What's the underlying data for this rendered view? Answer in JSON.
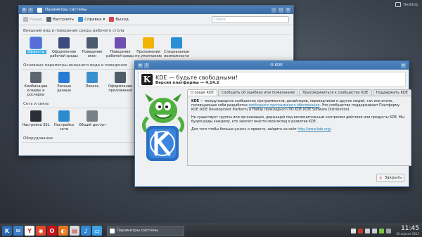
{
  "desktop": {
    "label": "Desktop"
  },
  "settings_window": {
    "title": "Параметры системы",
    "toolbar": {
      "back": "Назад",
      "configure": "Настроить",
      "help": "Справка",
      "quit": "Выход",
      "search_placeholder": "Поиск"
    },
    "sections": [
      {
        "title": "Внешний вид и поведение среды рабочего стола",
        "items": [
          {
            "label": "Эффекты",
            "icon": "effects-icon",
            "color": "#5b6bd6"
          },
          {
            "label": "Оформление рабочей среды",
            "icon": "workspace-theme-icon",
            "color": "#3c4a80"
          },
          {
            "label": "Поведение окон",
            "icon": "window-behavior-icon",
            "color": "#4a5a70"
          },
          {
            "label": "Поведение рабочей среды",
            "icon": "workspace-behavior-icon",
            "color": "#6e4fb0"
          },
          {
            "label": "Приложения по умолчанию",
            "icon": "star-icon",
            "color": "#f0b400"
          },
          {
            "label": "Специальные возможности",
            "icon": "accessibility-icon",
            "color": "#2b8fd6"
          }
        ]
      },
      {
        "title": "Основные параметры внешнего вида и поведения",
        "items": [
          {
            "label": "Комбинации клавиш и росчерки",
            "icon": "keyboard-icon",
            "color": "#5d6670"
          },
          {
            "label": "Личные данные",
            "icon": "user-icon",
            "color": "#2b7bd6"
          },
          {
            "label": "Локаль",
            "icon": "globe-icon",
            "color": "#3a8fd0"
          },
          {
            "label": "Оформление приложений",
            "icon": "app-style-icon",
            "color": "#4f5d6c"
          }
        ]
      },
      {
        "title": "Сеть и связь",
        "items": [
          {
            "label": "Настройка SSL",
            "icon": "ssl-icon",
            "color": "#2a2f35"
          },
          {
            "label": "Настройка сети",
            "icon": "network-icon",
            "color": "#2f8bd0"
          },
          {
            "label": "Общий доступ",
            "icon": "sharing-icon",
            "color": "#7a8088"
          }
        ]
      },
      {
        "title": "Оборудование",
        "items": []
      }
    ]
  },
  "about_dialog": {
    "window_title": "О KDE",
    "heading": "KDE — будьте свободными!",
    "version_line": "Версия платформы — 4.14.2",
    "tabs": [
      "О среде KDE",
      "Сообщить об ошибках или пожеланиях",
      "Присоединиться к сообществу KDE",
      "Поддержать KDE"
    ],
    "active_tab": 0,
    "paragraph1_bold": "KDE",
    "paragraph1_a": " — международное сообщество программистов, дизайнеров, переводчиков и других людей, так или иначе, посвящающих себя разработке ",
    "paragraph1_link": "свободного программного обеспечения",
    "paragraph1_b": ". Это сообщество поддерживает Платформу KDE (KDE Development Platform) и Набор прикладного ПО KDE (KDE Software Distribution).",
    "paragraph2": "Не существует группы или организации, держащей под исключительным контролем действия или продукты KDE. Мы будем рады каждому, кто захочет внести свой вклад в развитие KDE.",
    "paragraph3": "Для того чтобы больше узнать о проекте, зайдите на сайт ",
    "paragraph3_link": "http://www.kde.org/",
    "paragraph3_end": ".",
    "close_label": "Закрыть"
  },
  "taskbar": {
    "apps": [
      {
        "name": "kde-menu-icon",
        "color": "#2b6cb0",
        "glyph": "K"
      },
      {
        "name": "mail-icon",
        "color": "#3d7cc4",
        "glyph": "✉"
      },
      {
        "name": "yandex-browser-icon",
        "color": "#ffffff",
        "glyph": "Y"
      },
      {
        "name": "chrome-icon",
        "color": "#e0492f",
        "glyph": "◉"
      },
      {
        "name": "opera-icon",
        "color": "#cc0f16",
        "glyph": "O"
      },
      {
        "name": "firefox-icon",
        "color": "#e8761d",
        "glyph": "◐"
      },
      {
        "name": "files-icon",
        "color": "#d6d8da",
        "glyph": "▤"
      },
      {
        "name": "media-icon",
        "color": "#2f89d6",
        "glyph": "♪"
      },
      {
        "name": "dolphin-icon",
        "color": "#3ca3e6",
        "glyph": "▭"
      }
    ],
    "task_label": "Параметры системы",
    "time": "11:45",
    "date": "30 апреля 2015"
  }
}
